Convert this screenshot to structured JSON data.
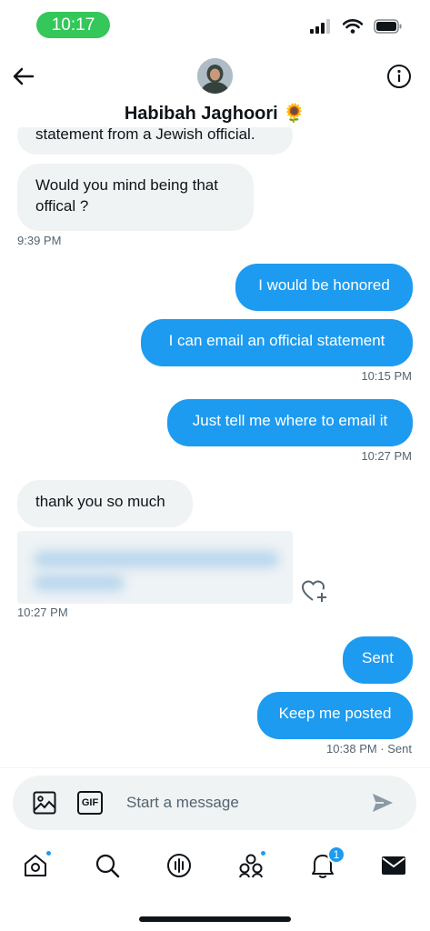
{
  "status_bar": {
    "time": "10:17"
  },
  "header": {
    "contact_name": "Habibah Jaghoori 🌻"
  },
  "messages": [
    {
      "direction": "in",
      "text": "statement from a Jewish official."
    },
    {
      "direction": "in",
      "text": "Would you mind being that offical ?"
    },
    {
      "direction": "out",
      "text": "I would be honored"
    },
    {
      "direction": "out",
      "text": "I can email an official statement"
    },
    {
      "direction": "out",
      "text": "Just tell me where to email it"
    },
    {
      "direction": "in",
      "text": "thank you so much"
    },
    {
      "direction": "out",
      "text": "Sent"
    },
    {
      "direction": "out",
      "text": "Keep me posted"
    }
  ],
  "timestamps": [
    "9:39 PM",
    "10:15 PM",
    "10:27 PM",
    "10:27 PM",
    "10:38 PM · Sent"
  ],
  "composer": {
    "placeholder": "Start a message",
    "gif_label": "GIF"
  },
  "nav": {
    "items": [
      "home-icon",
      "search-icon",
      "spaces-icon",
      "communities-icon",
      "notifications-icon",
      "messages-icon"
    ],
    "notification_count": "1"
  },
  "colors": {
    "accent": "#1d9bf0",
    "incoming": "#eff3f4",
    "status_green": "#34c759"
  }
}
